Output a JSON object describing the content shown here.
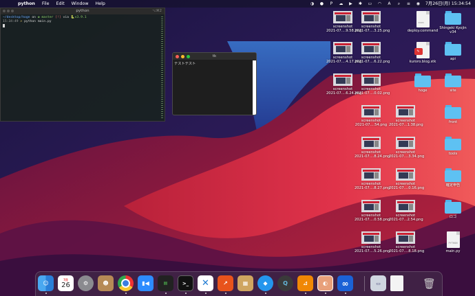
{
  "menubar": {
    "app_name": "python",
    "menus": [
      "File",
      "Edit",
      "Window",
      "Help"
    ],
    "datetime": "7月26日(月)  15:34:54"
  },
  "terminal": {
    "title": "python",
    "shortcut": "⌥⌘2",
    "path": "~/desktop/hoge",
    "on_word": " on ",
    "branch": "master",
    "status": "[!]",
    "via_word": " via ",
    "py_version": "v3.9.1",
    "time": "15:34:49",
    "prompt_arrow": ">",
    "command": "python main.py"
  },
  "tk_window": {
    "title": "tk",
    "label_text": "テストテスト"
  },
  "desktop_icons": [
    {
      "name": "screenshot-1",
      "type": "screenshot",
      "line1": "screenshot",
      "line2": "2021-07....9.58.png"
    },
    {
      "name": "screenshot-2",
      "type": "screenshot",
      "line1": "screenshot",
      "line2": "2021-07....3.25.png"
    },
    {
      "name": "deploy-command",
      "type": "doc",
      "line1": "deploy.command",
      "line2": "",
      "doc_tag": "exec"
    },
    {
      "name": "shingeki-folder",
      "type": "folder",
      "line1": "Shingeki Kyojin",
      "line2": "v34"
    },
    {
      "name": "screenshot-3",
      "type": "screenshot",
      "line1": "screenshot",
      "line2": "2021-07....4.17.png"
    },
    {
      "name": "screenshot-4",
      "type": "screenshot",
      "line1": "screenshot",
      "line2": "2021-07....6.22.png"
    },
    {
      "name": "kuroro-blog",
      "type": "doc-badge",
      "line1": "kuroro.blog.stk",
      "line2": ""
    },
    {
      "name": "api-folder",
      "type": "folder",
      "line1": "api",
      "line2": ""
    },
    {
      "name": "screenshot-5",
      "type": "screenshot",
      "line1": "screenshot",
      "line2": "2021-07....6.24.png"
    },
    {
      "name": "screenshot-6",
      "type": "screenshot",
      "line1": "screenshot",
      "line2": "2021-07....0.02.png"
    },
    {
      "name": "hoge-folder",
      "type": "folder",
      "line1": "hoge",
      "line2": ""
    },
    {
      "name": "site-folder",
      "type": "folder",
      "line1": "site",
      "line2": ""
    },
    {
      "name": "screenshot-7",
      "type": "screenshot",
      "line1": "screenshot",
      "line2": "2021-07....54.png"
    },
    {
      "name": "screenshot-8",
      "type": "screenshot",
      "line1": "screenshot",
      "line2": "2021-07...1.38.png"
    },
    {
      "name": "front-folder",
      "type": "folder",
      "line1": "front",
      "line2": ""
    },
    {
      "name": "screenshot-9",
      "type": "screenshot",
      "line1": "screenshot",
      "line2": "2021-07....8.24.png"
    },
    {
      "name": "screenshot-10",
      "type": "screenshot",
      "line1": "screenshot",
      "line2": "2021-07....3.34.png"
    },
    {
      "name": "tools-folder",
      "type": "folder",
      "line1": "tools",
      "line2": ""
    },
    {
      "name": "screenshot-11",
      "type": "screenshot",
      "line1": "screenshot",
      "line2": "2021-07....8.27.png"
    },
    {
      "name": "screenshot-12",
      "type": "screenshot",
      "line1": "screenshot",
      "line2": "2021-07....0.16.png"
    },
    {
      "name": "kakuteishinkoku-folder",
      "type": "folder",
      "line1": "確定申告",
      "line2": ""
    },
    {
      "name": "screenshot-13",
      "type": "screenshot",
      "line1": "screenshot",
      "line2": "2021-07....0.58.png"
    },
    {
      "name": "screenshot-14",
      "type": "screenshot",
      "line1": "screenshot",
      "line2": "2021-07...2.54.png"
    },
    {
      "name": "logo-folder",
      "type": "folder",
      "line1": "ロゴ",
      "line2": ""
    },
    {
      "name": "screenshot-15",
      "type": "screenshot",
      "line1": "screenshot",
      "line2": "2021-07....5.26.png"
    },
    {
      "name": "screenshot-16",
      "type": "screenshot",
      "line1": "screenshot",
      "line2": "2021-07....8.18.png"
    },
    {
      "name": "main-py",
      "type": "doc",
      "line1": "main.py",
      "line2": "",
      "doc_tag": "PYTHON"
    }
  ],
  "dock": {
    "calendar_month": "7月",
    "calendar_day": "26",
    "items": [
      "finder",
      "calendar",
      "system-preferences",
      "contacts",
      "chrome",
      "zoom",
      "activity-monitor",
      "terminal",
      "vscode",
      "sourcetree",
      "archive-utility",
      "docker",
      "quicktime",
      "drawio",
      "app-store-alt",
      "infinity",
      "preview",
      "document",
      "trash"
    ]
  }
}
